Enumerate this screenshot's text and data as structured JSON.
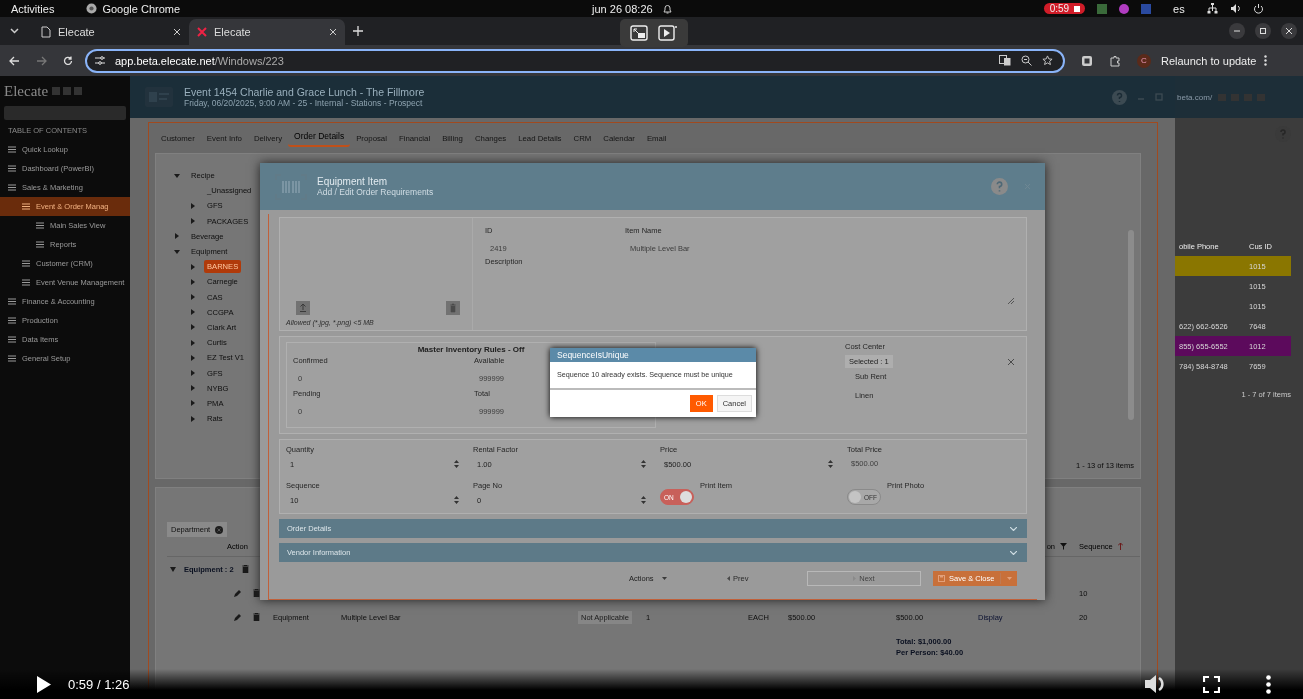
{
  "os_bar": {
    "activities": "Activities",
    "app": "Google Chrome",
    "clock": "jun 26  08:26",
    "recording": "0:59",
    "language": "es"
  },
  "browser": {
    "tabs": [
      {
        "title": "Elecate",
        "selected": false
      },
      {
        "title": "Elecate",
        "selected": true
      }
    ],
    "url_host": "app.beta.elecate.net",
    "url_path": "/Windows/223",
    "profile": "C",
    "relaunch": "Relaunch to update"
  },
  "sidebar": {
    "logo": "Elecate",
    "heading": "TABLE OF CONTENTS",
    "items": [
      {
        "label": "Quick Lookup",
        "selected": false
      },
      {
        "label": "Dashboard (PowerBI)",
        "selected": false
      },
      {
        "label": "Sales & Marketing",
        "selected": false,
        "children": [
          {
            "label": "Event & Order Manag",
            "selected": true,
            "children": [
              {
                "label": "Main Sales View",
                "selected": false
              },
              {
                "label": "Reports",
                "selected": false
              }
            ]
          },
          {
            "label": "Customer (CRM)",
            "selected": false
          },
          {
            "label": "Event Venue Management",
            "selected": false
          }
        ]
      },
      {
        "label": "Finance & Accounting",
        "selected": false
      },
      {
        "label": "Production",
        "selected": false
      },
      {
        "label": "Data Items",
        "selected": false
      },
      {
        "label": "General Setup",
        "selected": false
      }
    ]
  },
  "event": {
    "title": "Event 1454 Charlie and Grace Lunch - The Fillmore",
    "subtitle": "Friday, 06/20/2025, 9:00 AM - 25 - Internal - Stations - Prospect"
  },
  "event_tabs": [
    {
      "label": "Customer",
      "selected": false
    },
    {
      "label": "Event Info",
      "selected": false
    },
    {
      "label": "Delivery",
      "selected": false
    },
    {
      "label": "Order Details",
      "selected": true
    },
    {
      "label": "Proposal",
      "selected": false
    },
    {
      "label": "Financial",
      "selected": false
    },
    {
      "label": "Billing",
      "selected": false
    },
    {
      "label": "Changes",
      "selected": false
    },
    {
      "label": "Lead Details",
      "selected": false
    },
    {
      "label": "CRM",
      "selected": false
    },
    {
      "label": "Calendar",
      "selected": false
    },
    {
      "label": "Email",
      "selected": false
    }
  ],
  "tree": [
    {
      "label": "Recipe",
      "kind": "folder",
      "expanded": true,
      "selected": false,
      "children": [
        {
          "label": "_Unassigned",
          "kind": "leaf",
          "selected": false
        },
        {
          "label": "GFS",
          "kind": "folder",
          "expanded": false,
          "selected": false
        },
        {
          "label": "PACKAGES",
          "kind": "folder",
          "expanded": false,
          "selected": false
        }
      ]
    },
    {
      "label": "Beverage",
      "kind": "folder",
      "expanded": false,
      "selected": false
    },
    {
      "label": "Equipment",
      "kind": "folder",
      "expanded": true,
      "selected": false,
      "children": [
        {
          "label": "BARNES",
          "kind": "folder",
          "expanded": false,
          "selected": true
        },
        {
          "label": "Carnegie",
          "kind": "folder",
          "expanded": false,
          "selected": false
        },
        {
          "label": "CAS",
          "kind": "folder",
          "expanded": false,
          "selected": false
        },
        {
          "label": "CCGPA",
          "kind": "folder",
          "expanded": false,
          "selected": false
        },
        {
          "label": "Clark Art",
          "kind": "folder",
          "expanded": false,
          "selected": false
        },
        {
          "label": "Curtis",
          "kind": "folder",
          "expanded": false,
          "selected": false
        },
        {
          "label": "EZ Test V1",
          "kind": "folder",
          "expanded": false,
          "selected": false
        },
        {
          "label": "GFS",
          "kind": "folder",
          "expanded": false,
          "selected": false
        },
        {
          "label": "NYBG",
          "kind": "folder",
          "expanded": false,
          "selected": false
        },
        {
          "label": "PMA",
          "kind": "folder",
          "expanded": false,
          "selected": false
        },
        {
          "label": "Rats",
          "kind": "folder",
          "expanded": false,
          "selected": false
        }
      ]
    }
  ],
  "items_pager": "1 - 13 of 13 items",
  "order_grid": {
    "group_chip": "Department",
    "columns": {
      "action": "Action",
      "column_9": "on",
      "sequence": "Sequence"
    },
    "group": "Equipment : 2",
    "rows": [
      {
        "sequence": "10"
      },
      {
        "department": "Equipment",
        "item": "Multiple Level Bar",
        "status": "Not Applicable",
        "quantity": "1",
        "unit": "EACH",
        "price": "$500.00",
        "total": "$500.00",
        "type": "Display",
        "sequence": "20"
      }
    ],
    "total": "Total: $1,000.00",
    "per_person": "Per Person: $40.00"
  },
  "background_window": {
    "url": "beta.com/",
    "columns": [
      "obile Phone",
      "Cus ID"
    ],
    "rows": [
      {
        "phone": "",
        "id": "1015",
        "color": "#8a7600"
      },
      {
        "phone": "",
        "id": "1015"
      },
      {
        "phone": "",
        "id": "1015"
      },
      {
        "phone": "622) 662-6526",
        "id": "7648"
      },
      {
        "phone": "855) 655-6552",
        "id": "1012",
        "color": "#5c0a5c"
      },
      {
        "phone": "784) 584-8748",
        "id": "7659"
      }
    ],
    "pager": "1 - 7 of 7 items"
  },
  "modal": {
    "title": "Equipment Item",
    "subtitle": "Add / Edit Order Requirements",
    "upload_hint": "Allowed (*.jpg, *.png) <5 MB",
    "id": {
      "label": "ID",
      "value": "2419"
    },
    "item_name": {
      "label": "Item Name",
      "value": "Multiple Level Bar"
    },
    "description": {
      "label": "Description"
    },
    "inventory": {
      "title": "Master Inventory Rules - Off",
      "fields": [
        {
          "label": "Confirmed",
          "value": "0"
        },
        {
          "label": "Available",
          "value": "999999"
        },
        {
          "label": "Pending",
          "value": "0"
        },
        {
          "label": "Total",
          "value": "999999"
        }
      ]
    },
    "cost_center": {
      "label": "Cost Center",
      "value": "Selected : 1",
      "options": [
        "Sub Rent",
        "Linen"
      ]
    },
    "numbers": [
      {
        "label": "Quantity",
        "value": "1",
        "spinner": true
      },
      {
        "label": "Rental Factor",
        "value": "1.00",
        "spinner": true
      },
      {
        "label": "Price",
        "value": "$500.00",
        "spinner": true
      },
      {
        "label": "Total Price",
        "value": "$500.00",
        "spinner": false
      },
      {
        "label": "Sequence",
        "value": "10",
        "spinner": true
      },
      {
        "label": "Page No",
        "value": "0",
        "spinner": true
      }
    ],
    "toggles": [
      {
        "label": "Print Item",
        "on": true,
        "text": "ON"
      },
      {
        "label": "Print Photo",
        "on": false,
        "text": "OFF"
      }
    ],
    "sections": [
      "Order Details",
      "Vendor Information"
    ],
    "footer": {
      "actions": "Actions",
      "prev": "Prev",
      "next": "Next",
      "save": "Save & Close"
    }
  },
  "dialog": {
    "title": "SequenceIsUnique",
    "message": "Sequence 10 already exists. Sequence must be unique",
    "ok": "OK",
    "cancel": "Cancel"
  },
  "video": {
    "time": "0:59 / 1:26"
  }
}
